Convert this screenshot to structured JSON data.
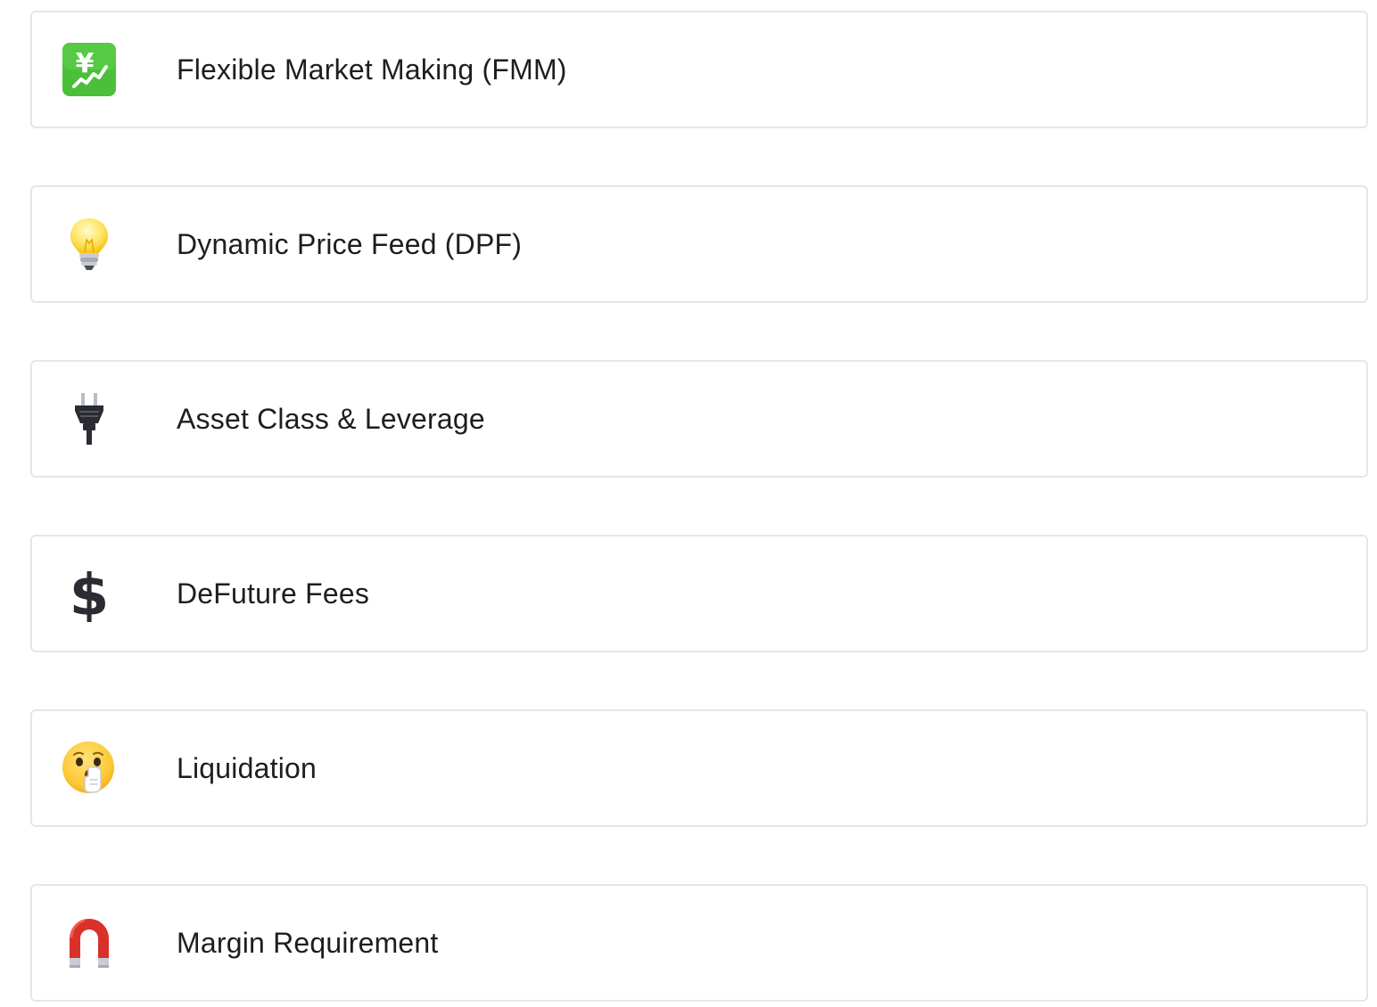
{
  "cards": [
    {
      "label": "Flexible Market Making (FMM)",
      "icon": "chart-increasing-yen-icon"
    },
    {
      "label": "Dynamic Price Feed (DPF)",
      "icon": "light-bulb-icon"
    },
    {
      "label": "Asset Class & Leverage",
      "icon": "electric-plug-icon"
    },
    {
      "label": "DeFuture Fees",
      "icon": "dollar-sign-icon"
    },
    {
      "label": "Liquidation",
      "icon": "shushing-face-icon"
    },
    {
      "label": "Margin Requirement",
      "icon": "magnet-icon"
    }
  ],
  "colors": {
    "border": "#e6e6e9",
    "text": "#1c1e21",
    "yen_tile": "#4cbf3a",
    "magnet_red": "#d9302a",
    "bulb_yellow": "#ffe566",
    "face_yellow": "#fcc935"
  }
}
